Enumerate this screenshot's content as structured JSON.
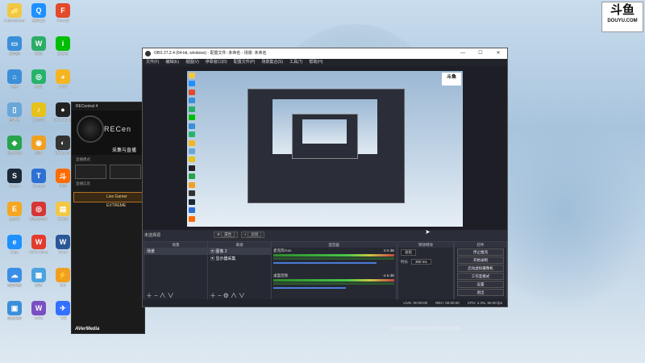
{
  "watermark": {
    "logo": "斗鱼",
    "domain": "DOUYU.COM"
  },
  "desktop_icons": [
    {
      "label": "Administrator",
      "color": "#f2c744",
      "glyph": "📁"
    },
    {
      "label": "腾讯QQ",
      "color": "#1e90ff",
      "glyph": "Q"
    },
    {
      "label": "Foxmail",
      "color": "#e34a2b",
      "glyph": "F"
    },
    {
      "label": "此电脑",
      "color": "#3b8fd9",
      "glyph": "▭"
    },
    {
      "label": "微信",
      "color": "#2aae67",
      "glyph": "W"
    },
    {
      "label": "爱奇艺",
      "color": "#00be06",
      "glyph": "i"
    },
    {
      "label": "网络",
      "color": "#3b8fd9",
      "glyph": "⌂"
    },
    {
      "label": "绿联",
      "color": "#27b36b",
      "glyph": "◎"
    },
    {
      "label": "WPS",
      "color": "#f5b522",
      "glyph": "◕"
    },
    {
      "label": "回收站",
      "color": "#6aa6d8",
      "glyph": "▯"
    },
    {
      "label": "QQ音乐",
      "color": "#e6c21a",
      "glyph": "♪"
    },
    {
      "label": "OBS Studio",
      "color": "#222",
      "glyph": "●"
    },
    {
      "label": "控制面板",
      "color": "#27a34a",
      "glyph": "◆"
    },
    {
      "label": "迅雷",
      "color": "#f0a020",
      "glyph": "◉"
    },
    {
      "label": "RECentral",
      "color": "#333",
      "glyph": "◐"
    },
    {
      "label": "Steam",
      "color": "#1b2838",
      "glyph": "S"
    },
    {
      "label": "Tencent",
      "color": "#2d6fd3",
      "glyph": "T"
    },
    {
      "label": "斗鱼",
      "color": "#ff6b00",
      "glyph": "斗"
    },
    {
      "label": "易企秀",
      "color": "#f5a623",
      "glyph": "E"
    },
    {
      "label": "网易云音乐",
      "color": "#d63636",
      "glyph": "◎"
    },
    {
      "label": "文件夹",
      "color": "#f2c744",
      "glyph": "▤"
    },
    {
      "label": "Edge",
      "color": "#1e90ff",
      "glyph": "e"
    },
    {
      "label": "WPS Office",
      "color": "#e33b2e",
      "glyph": "W"
    },
    {
      "label": "Word",
      "color": "#2b5797",
      "glyph": "W"
    },
    {
      "label": "百度网盘",
      "color": "#3a8ee6",
      "glyph": "☁"
    },
    {
      "label": "应用",
      "color": "#4aa3df",
      "glyph": "▦"
    },
    {
      "label": "360",
      "color": "#f0a020",
      "glyph": "⚡"
    },
    {
      "label": "应用商店",
      "color": "#3b8fd9",
      "glyph": "▣"
    },
    {
      "label": "WPS",
      "color": "#7a4fc2",
      "glyph": "W"
    },
    {
      "label": "飞书",
      "color": "#3370ff",
      "glyph": "✈"
    }
  ],
  "recentral": {
    "title": "RECentral 4",
    "brand": "RECen",
    "mode_label": "采集与直播",
    "section1": "直播模式",
    "section2": "直播信息",
    "device": "Live Gamer EXTREME",
    "logo": "AVerMedia"
  },
  "obs": {
    "title": "OBS 27.2.4 (64-bit, windows) - 配置文件: 未命名 - 场景: 未命名",
    "menu": [
      "文件(F)",
      "编辑(E)",
      "视图(V)",
      "停靠窗口(D)",
      "配置文件(P)",
      "场景集合(S)",
      "工具(T)",
      "帮助(H)"
    ],
    "no_source": "未选择源",
    "props_btn": "属性",
    "filters_btn": "滤镜",
    "docks": {
      "scenes": {
        "title": "场景",
        "items": [
          "场景"
        ]
      },
      "sources": {
        "title": "来源",
        "items": [
          "图像 2",
          "显示器采集"
        ]
      },
      "mixer": {
        "title": "混音器",
        "channels": [
          {
            "name": "麦克风/Aux",
            "db": "0.0 dB"
          },
          {
            "name": "桌面音频",
            "db": "-4.6 dB"
          }
        ]
      },
      "transitions": {
        "title": "转场特效",
        "type": "淡化",
        "duration_label": "时长",
        "duration": "300 ms"
      },
      "controls": {
        "title": "控件",
        "buttons": [
          "停止推流",
          "开始录制",
          "启动虚拟摄像机",
          "工作室模式",
          "设置",
          "退出"
        ]
      }
    },
    "status": {
      "live": "LIVE: 00:00:00",
      "rec": "REC: 00:00:00",
      "cpu": "CPU: 2.3%, 60.00 fps"
    }
  },
  "bottom_status": "CPU 62.19%  RAM 10.43GB  60.00 FPS"
}
